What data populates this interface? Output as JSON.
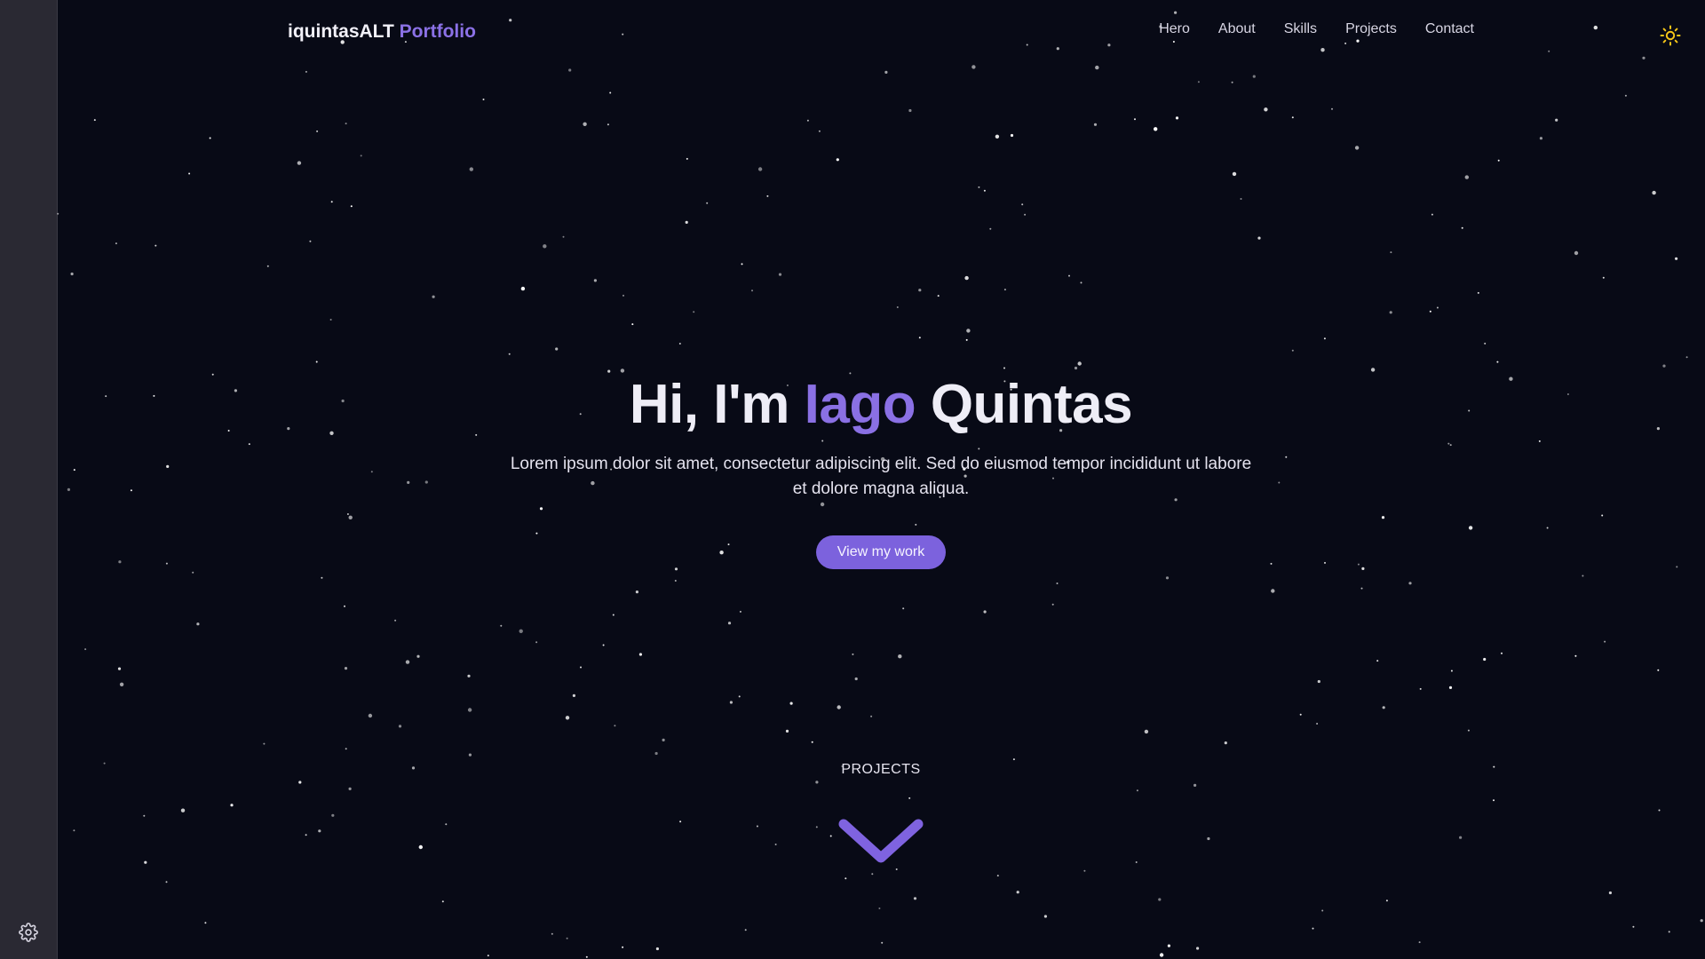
{
  "brand": {
    "name": "iquintasALT",
    "suffix": "Portfolio",
    "accent_color": "#8b71e6"
  },
  "nav": {
    "items": [
      {
        "label": "Hero"
      },
      {
        "label": "About"
      },
      {
        "label": "Skills"
      },
      {
        "label": "Projects"
      },
      {
        "label": "Contact"
      }
    ]
  },
  "theme_toggle": {
    "icon": "sun-icon",
    "color": "#f5c518"
  },
  "sidebar": {
    "settings_icon": "gear-icon"
  },
  "hero": {
    "greeting": "Hi, I'm",
    "first_name": "Iago",
    "last_name": "Quintas",
    "subtitle": "Lorem ipsum dolor sit amet, consectetur adipiscing elit. Sed do eiusmod tempor incididunt ut labore et dolore magna aliqua.",
    "cta_label": "View my work",
    "cta_color": "#7c62dd"
  },
  "scroll_hint": {
    "label": "PROJECTS",
    "icon": "chevron-down-icon",
    "color": "#7f63e0"
  },
  "background": {
    "color": "#080a16",
    "decoration": "starfield"
  }
}
